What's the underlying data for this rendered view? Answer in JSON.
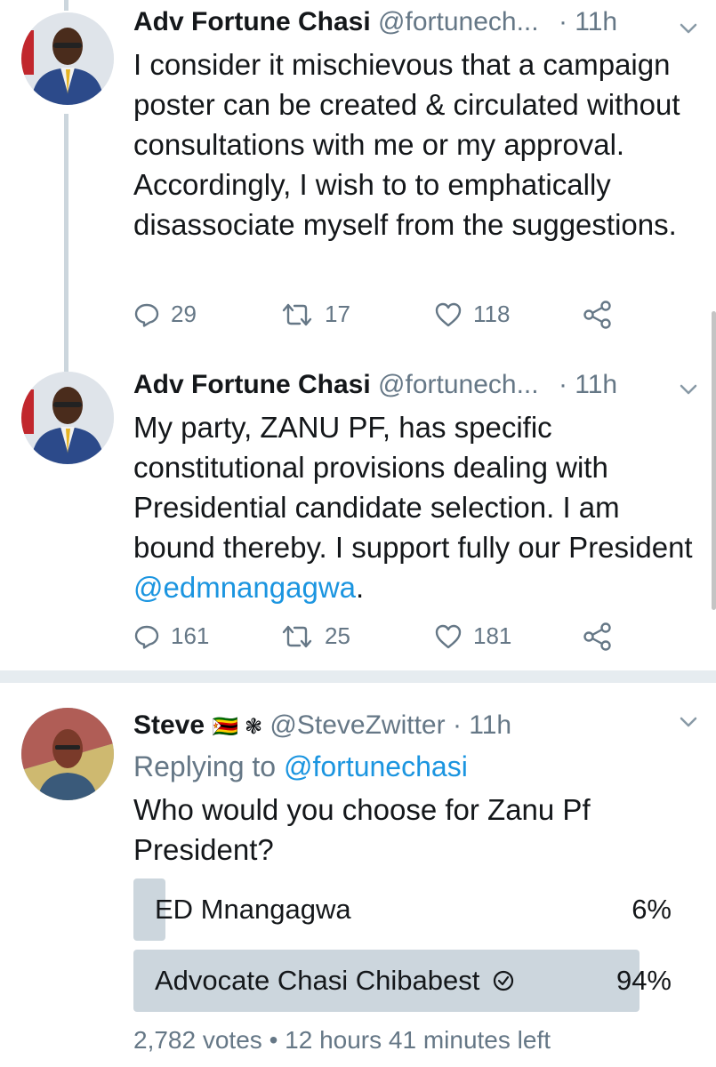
{
  "tweets": [
    {
      "name": "Adv Fortune Chasi",
      "handle": "@fortunech...",
      "dot": "·",
      "time": "11h",
      "text": "I consider it mischievous that a campaign poster can be created & circulated without consultations with me or my approval. Accordingly, I wish to to emphatically disassociate myself from the suggestions.",
      "replies": "29",
      "retweets": "17",
      "likes": "118"
    },
    {
      "name": "Adv Fortune Chasi",
      "handle": "@fortunech...",
      "dot": "·",
      "time": "11h",
      "text_before": "My party, ZANU PF, has specific constitutional provisions dealing with Presidential candidate selection. I am bound thereby. I support fully our President ",
      "mention": "@edmnangagwa",
      "text_after": ".",
      "replies": "161",
      "retweets": "25",
      "likes": "181"
    }
  ],
  "reply": {
    "name": "Steve",
    "emoji": "🇿🇼 ❃",
    "handle": "@SteveZwitter",
    "dot": "·",
    "time": "11h",
    "replying_prefix": "Replying to ",
    "replying_to": "@fortunechasi",
    "text": "Who would you choose for Zanu Pf President?",
    "poll": {
      "options": [
        {
          "label": "ED Mnangagwa",
          "percent_text": "6%",
          "percent": 6
        },
        {
          "label": "Advocate Chasi Chibabest",
          "percent_text": "94%",
          "percent": 94
        }
      ],
      "votes": "2,782 votes",
      "separator": "•",
      "remaining": "12 hours 41 minutes left"
    }
  },
  "colors": {
    "secondary_text": "#657786",
    "link": "#1b95e0",
    "thread_line": "#ccd6dd",
    "poll_bar": "#ccd6dd"
  },
  "icons": [
    "reply-icon",
    "retweet-icon",
    "like-icon",
    "share-icon",
    "chevron-down-icon",
    "check-circle-icon"
  ]
}
